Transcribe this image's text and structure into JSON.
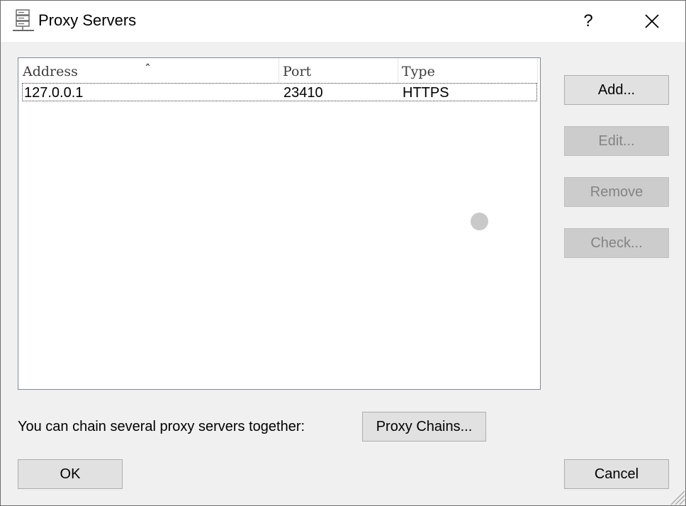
{
  "window": {
    "title": "Proxy Servers",
    "help_glyph": "?",
    "close_glyph": "✕",
    "icon": "server-icon"
  },
  "list": {
    "columns": [
      "Address",
      "Port",
      "Type"
    ],
    "sorted_column": "Address",
    "sort_glyph": "ˆ",
    "rows": [
      {
        "address": "127.0.0.1",
        "port": "23410",
        "type": "HTTPS"
      }
    ]
  },
  "buttons": {
    "add": "Add...",
    "edit": "Edit...",
    "remove": "Remove",
    "check": "Check...",
    "proxy_chains": "Proxy Chains...",
    "ok": "OK",
    "cancel": "Cancel"
  },
  "chain_label": "You can chain several proxy servers together:",
  "colors": {
    "background": "#f0f0f0",
    "titlebar": "#ffffff",
    "button": "#e1e1e1",
    "button_disabled": "#cccccc",
    "text_disabled": "#838383"
  }
}
